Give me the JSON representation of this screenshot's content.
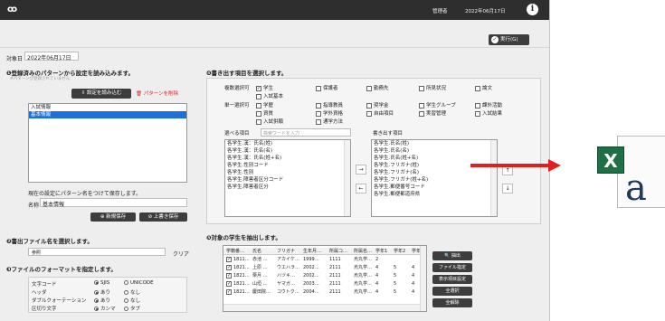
{
  "app": {
    "logo": "ꝏ",
    "user": "管理者",
    "date": "2022年06月17日",
    "info_glyph": "i",
    "run_label": "実行(G)"
  },
  "target_date": {
    "label": "対象日",
    "value": "2022年06月17日"
  },
  "section1": {
    "title": "❶登録済みのパターンから設定を読み込みます。",
    "hint": "※パターンが登録されていません",
    "load_button": "設定を読み込む",
    "delete_button": "パターンを削除",
    "patterns": [
      "入試情報",
      "基本情報"
    ],
    "selected_index": 1,
    "save_prompt": "現在の設定にパターン名をつけて保存します。",
    "name_label": "名称",
    "name_value": "基本情報",
    "new_save": "新規保存",
    "overwrite_save": "上書き保存"
  },
  "section2": {
    "title": "❷書出ファイル名を選択します。",
    "browse": "参照",
    "clear": "クリア"
  },
  "section3": {
    "title": "❸ファイルのフォーマットを指定します。",
    "rows": [
      {
        "label": "文字コード",
        "opt1": "SJIS",
        "opt2": "UNICODE"
      },
      {
        "label": "ヘッダ",
        "opt1": "あり",
        "opt2": "なし"
      },
      {
        "label": "ダブルクォーテーション",
        "opt1": "あり",
        "opt2": "なし"
      },
      {
        "label": "区切り文字",
        "opt1": "カンマ",
        "opt2": "タブ"
      }
    ]
  },
  "section4": {
    "title": "❹書き出す項目を選択します。",
    "multi_label": "複数選択可",
    "single_label": "単一選択可",
    "multi_options": [
      "学生",
      "保護者",
      "勤務先",
      "所見状況",
      "論文"
    ],
    "multi_options2": [
      "入試基本"
    ],
    "single_options": [
      "学歴",
      "指導教員",
      "奨学金",
      "学生グループ",
      "課外活動"
    ],
    "single_options2": [
      "資質",
      "学外資格",
      "自由項目",
      "実習管理",
      "入試結果"
    ],
    "single_options3": [
      "入試併願",
      "通学方法"
    ],
    "available_label": "選べる項目",
    "search_placeholder": "検索ワードを入力",
    "available_items": [
      "各学生.漢：氏名(姓)",
      "各学生.漢：氏名(名)",
      "各学生.漢：氏名(姓+名)",
      "各学生.性別コード",
      "各学生.性別",
      "各学生.障害者区分コード",
      "各学生.障害者区分"
    ],
    "export_label": "書き出す項目",
    "export_items": [
      "各学生.氏名(姓)",
      "各学生.氏名(名)",
      "各学生.氏名(姓+名)",
      "各学生.フリガナ(姓)",
      "各学生.フリガナ(名)",
      "各学生.フリガナ(姓+名)",
      "各学生.郵便番号コード",
      "各学生.郵便都道府県"
    ],
    "add": "→",
    "remove": "←",
    "up": "↑",
    "down": "↓"
  },
  "section5": {
    "title": "❺対象の学生を抽出します。",
    "columns": [
      "学籍番…",
      "氏名",
      "フリガナ",
      "生年月…",
      "所属コ…",
      "所属名…",
      "学年1",
      "学年2",
      "学年"
    ],
    "rows": [
      [
        "1811…",
        "赤池 …",
        "アカイケ…",
        "1999…",
        "1111",
        "烏丸学…",
        "2",
        "",
        ""
      ],
      [
        "1821…",
        "上原 …",
        "ウエハラ…",
        "2002…",
        "2111",
        "烏丸学…",
        "4",
        "5",
        "4"
      ],
      [
        "1821…",
        "栗月 …",
        "ハヅキ…",
        "2002…",
        "2111",
        "烏丸学…",
        "4",
        "5",
        "4"
      ],
      [
        "1821…",
        "山垣 …",
        "ヤマガ…",
        "2003…",
        "2111",
        "烏丸学…",
        "4",
        "5",
        "4"
      ],
      [
        "1821…",
        "慶田院…",
        "コウトク…",
        "2004…",
        "2111",
        "烏丸学…",
        "4",
        "5",
        "4"
      ]
    ],
    "buttons": [
      "抽出",
      "ファイル指定",
      "表示項目設定",
      "全選択",
      "全解除"
    ]
  },
  "colors": {
    "excel_green": "#1e7145",
    "arrow_red": "#e02020",
    "accent_blue": "#1e6fd9",
    "topbar": "#2e2e2e"
  },
  "excel_icon": {
    "letter": "X",
    "file_text": "a"
  }
}
